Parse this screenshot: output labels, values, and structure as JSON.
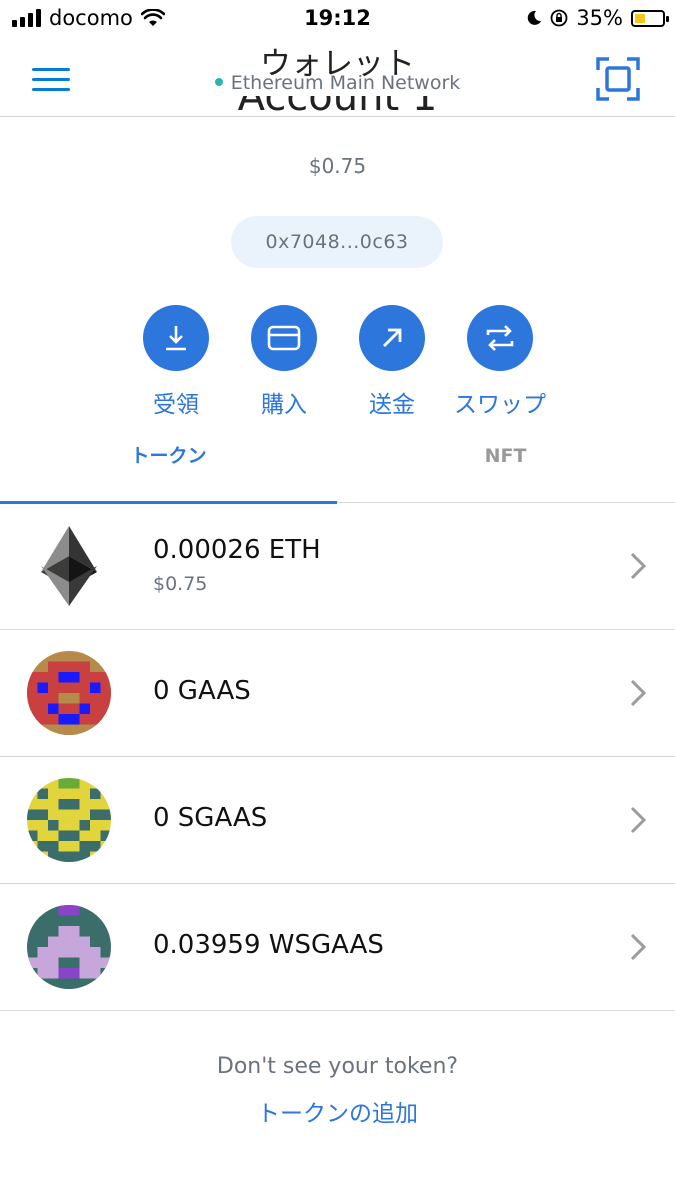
{
  "status_bar": {
    "carrier": "docomo",
    "time": "19:12",
    "battery": "35%"
  },
  "header": {
    "title": "ウォレット",
    "network": "Ethereum Main Network"
  },
  "account": {
    "name": "Account 1",
    "balance": "$0.75",
    "address": "0x7048...0c63"
  },
  "actions": [
    {
      "label": "受領",
      "icon": "download-icon"
    },
    {
      "label": "購入",
      "icon": "card-icon"
    },
    {
      "label": "送金",
      "icon": "arrow-up-right-icon"
    },
    {
      "label": "スワップ",
      "icon": "swap-icon"
    }
  ],
  "tabs": [
    {
      "label": "トークン",
      "active": true
    },
    {
      "label": "NFT",
      "active": false
    }
  ],
  "tokens": [
    {
      "amount": "0.00026 ETH",
      "fiat": "$0.75",
      "icon": "eth-icon"
    },
    {
      "amount": "0 GAAS",
      "fiat": "",
      "icon": "gaas-icon"
    },
    {
      "amount": "0 SGAAS",
      "fiat": "",
      "icon": "sgaas-icon"
    },
    {
      "amount": "0.03959 WSGAAS",
      "fiat": "",
      "icon": "wsgaas-icon"
    }
  ],
  "footer": {
    "prompt": "Don't see your token?",
    "add_link": "トークンの追加"
  },
  "colors": {
    "accent": "#2c76dc",
    "network_dot": "#29b6af",
    "muted": "#6a737d"
  }
}
